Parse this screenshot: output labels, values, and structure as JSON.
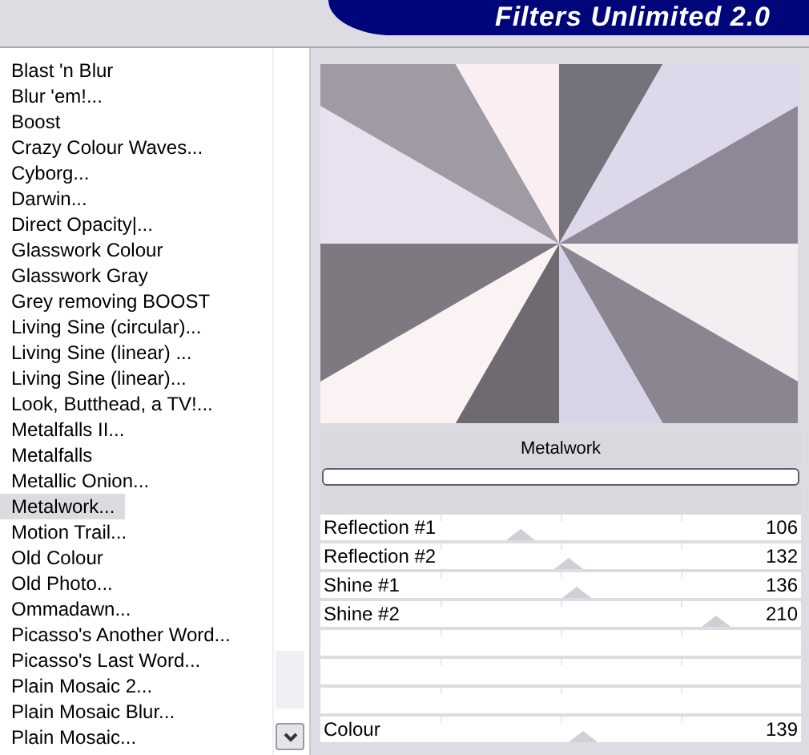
{
  "header": {
    "title": "Filters Unlimited 2.0"
  },
  "filters": [
    {
      "label": "Blast 'n Blur",
      "selected": false
    },
    {
      "label": "Blur 'em!...",
      "selected": false
    },
    {
      "label": "Boost",
      "selected": false
    },
    {
      "label": "Crazy Colour Waves...",
      "selected": false
    },
    {
      "label": "Cyborg...",
      "selected": false
    },
    {
      "label": "Darwin...",
      "selected": false
    },
    {
      "label": "Direct Opacity|...",
      "selected": false
    },
    {
      "label": "Glasswork Colour",
      "selected": false
    },
    {
      "label": "Glasswork Gray",
      "selected": false
    },
    {
      "label": "Grey removing BOOST",
      "selected": false
    },
    {
      "label": "Living Sine (circular)...",
      "selected": false
    },
    {
      "label": "Living Sine (linear) ...",
      "selected": false
    },
    {
      "label": "Living Sine (linear)...",
      "selected": false
    },
    {
      "label": "Look, Butthead, a TV!...",
      "selected": false
    },
    {
      "label": "Metalfalls II...",
      "selected": false
    },
    {
      "label": "Metalfalls",
      "selected": false
    },
    {
      "label": "Metallic Onion...",
      "selected": false
    },
    {
      "label": "Metalwork...",
      "selected": true
    },
    {
      "label": "Motion Trail...",
      "selected": false
    },
    {
      "label": "Old Colour",
      "selected": false
    },
    {
      "label": "Old Photo...",
      "selected": false
    },
    {
      "label": "Ommadawn...",
      "selected": false
    },
    {
      "label": "Picasso's Another Word...",
      "selected": false
    },
    {
      "label": "Picasso's Last Word...",
      "selected": false
    },
    {
      "label": "Plain Mosaic 2...",
      "selected": false
    },
    {
      "label": "Plain Mosaic Blur...",
      "selected": false
    },
    {
      "label": "Plain Mosaic...",
      "selected": false
    }
  ],
  "filter_name": "Metalwork",
  "sliders": [
    {
      "kind": "slider",
      "label": "Reflection #1",
      "value": "106",
      "level": 0.416
    },
    {
      "kind": "slider",
      "label": "Reflection #2",
      "value": "132",
      "level": 0.518
    },
    {
      "kind": "slider",
      "label": "Shine #1",
      "value": "136",
      "level": 0.533
    },
    {
      "kind": "slider",
      "label": "Shine #2",
      "value": "210",
      "level": 0.824
    },
    {
      "kind": "blank"
    },
    {
      "kind": "blank"
    },
    {
      "kind": "blank"
    },
    {
      "kind": "slider",
      "label": "Colour",
      "value": "139",
      "level": 0.545
    }
  ]
}
